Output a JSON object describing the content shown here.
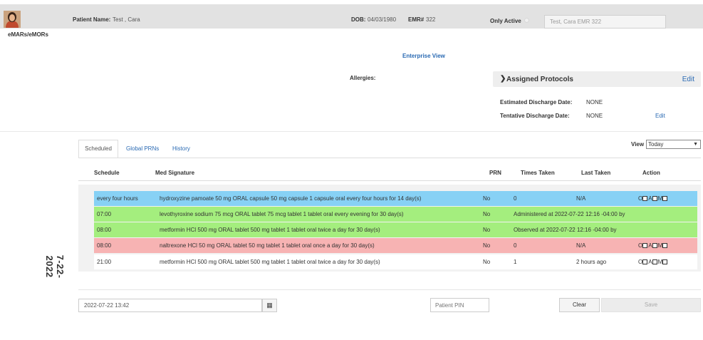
{
  "header": {
    "patient_name_label": "Patient Name:",
    "patient_name": "Test , Cara",
    "dob_label": "DOB:",
    "dob": "04/03/1980",
    "emr_label": "EMR#",
    "emr": "322",
    "only_active_label": "Only Active",
    "search_value": "Test, Cara EMR 322"
  },
  "app_label": "eMARs/eMORs",
  "enterprise_view": "Enterprise View",
  "allergies_label": "Allergies:",
  "protocols": {
    "title": "Assigned Protocols",
    "edit": "Edit"
  },
  "discharge": {
    "estimated_label": "Estimated Discharge Date:",
    "estimated_value": "NONE",
    "tentative_label": "Tentative Discharge Date:",
    "tentative_value": "NONE",
    "edit": "Edit"
  },
  "tabs": [
    "Scheduled",
    "Global PRNs",
    "History"
  ],
  "view": {
    "label": "View",
    "selected": "Today"
  },
  "table": {
    "columns": [
      "Schedule",
      "Med Signature",
      "PRN",
      "Times Taken",
      "Last Taken",
      "Action"
    ],
    "date_label": "7-22-2022",
    "rows": [
      {
        "schedule": "every four hours",
        "med": "hydroxyzine pamoate 50 mg ORAL capsule 50 mg capsule 1 capsule oral every four hours for 14 day(s)",
        "prn": "No",
        "times": "0",
        "last": "N/A",
        "color": "#87d1f5",
        "actions": true
      },
      {
        "schedule": "07:00",
        "med": "levothyroxine sodium 75 mcg ORAL tablet 75 mcg tablet 1 tablet oral every evening for 30 day(s)",
        "prn": "No",
        "times": "Administered at 2022-07-22 12:16 -04:00 by",
        "last": "",
        "color": "#a4ee7e",
        "actions": false
      },
      {
        "schedule": "08:00",
        "med": "metformin HCl 500 mg ORAL tablet 500 mg tablet 1 tablet oral twice a day for 30 day(s)",
        "prn": "No",
        "times": "Observed at 2022-07-22 12:16 -04:00 by",
        "last": "",
        "color": "#a4ee7e",
        "actions": false
      },
      {
        "schedule": "08:00",
        "med": "naltrexone HCl 50 mg ORAL tablet 50 mg tablet 1 tablet oral once a day for 30 day(s)",
        "prn": "No",
        "times": "0",
        "last": "N/A",
        "color": "#f7b3b3",
        "actions": true
      },
      {
        "schedule": "21:00",
        "med": "metformin HCl 500 mg ORAL tablet 500 mg tablet 1 tablet oral twice a day for 30 day(s)",
        "prn": "No",
        "times": "1",
        "last": "2 hours ago",
        "color": "#ffffff",
        "actions": true
      }
    ],
    "action_letters": [
      "O",
      "A",
      "M"
    ]
  },
  "footer": {
    "datetime": "2022-07-22 13:42",
    "pin_placeholder": "Patient PIN",
    "clear": "Clear",
    "save": "Save"
  },
  "icons": {
    "avatar": "patient-avatar",
    "calendar": "calendar-icon",
    "chevron": "chevron-right-icon"
  }
}
